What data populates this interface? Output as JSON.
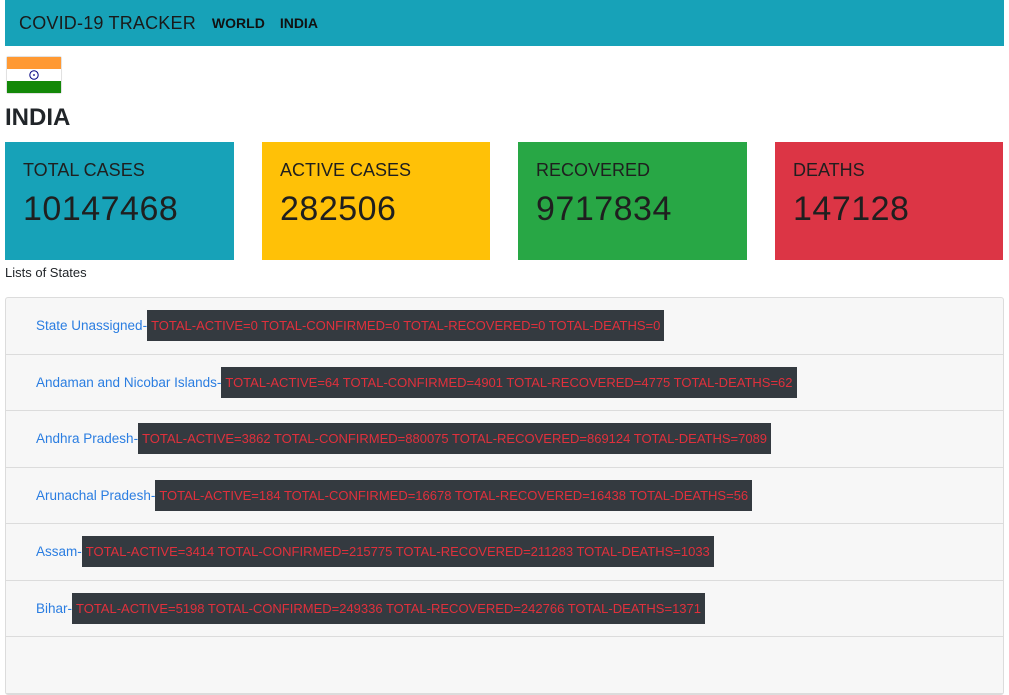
{
  "navbar": {
    "brand": "COVID-19 TRACKER",
    "links": [
      "WORLD",
      "INDIA"
    ],
    "color": "#17a2b8"
  },
  "country": {
    "flag_icon": "india-flag-icon",
    "name": "INDIA"
  },
  "summary_cards": [
    {
      "label": "TOTAL CASES",
      "value": "10147468",
      "color": "#17a2b8"
    },
    {
      "label": "ACTIVE CASES",
      "value": "282506",
      "color": "#ffc107"
    },
    {
      "label": "RECOVERED",
      "value": "9717834",
      "color": "#28a745"
    },
    {
      "label": "DEATHS",
      "value": "147128",
      "color": "#dc3545"
    }
  ],
  "states_caption": "Lists of States",
  "states": [
    {
      "name": "State Unassigned-",
      "stats": "TOTAL-ACTIVE=0 TOTAL-CONFIRMED=0 TOTAL-RECOVERED=0 TOTAL-DEATHS=0"
    },
    {
      "name": "Andaman and Nicobar Islands-",
      "stats": "TOTAL-ACTIVE=64 TOTAL-CONFIRMED=4901 TOTAL-RECOVERED=4775 TOTAL-DEATHS=62"
    },
    {
      "name": "Andhra Pradesh-",
      "stats": "TOTAL-ACTIVE=3862 TOTAL-CONFIRMED=880075 TOTAL-RECOVERED=869124 TOTAL-DEATHS=7089"
    },
    {
      "name": "Arunachal Pradesh-",
      "stats": "TOTAL-ACTIVE=184 TOTAL-CONFIRMED=16678 TOTAL-RECOVERED=16438 TOTAL-DEATHS=56"
    },
    {
      "name": "Assam-",
      "stats": "TOTAL-ACTIVE=3414 TOTAL-CONFIRMED=215775 TOTAL-RECOVERED=211283 TOTAL-DEATHS=1033"
    },
    {
      "name": "Bihar-",
      "stats": "TOTAL-ACTIVE=5198 TOTAL-CONFIRMED=249336 TOTAL-RECOVERED=242766 TOTAL-DEATHS=1371"
    }
  ]
}
